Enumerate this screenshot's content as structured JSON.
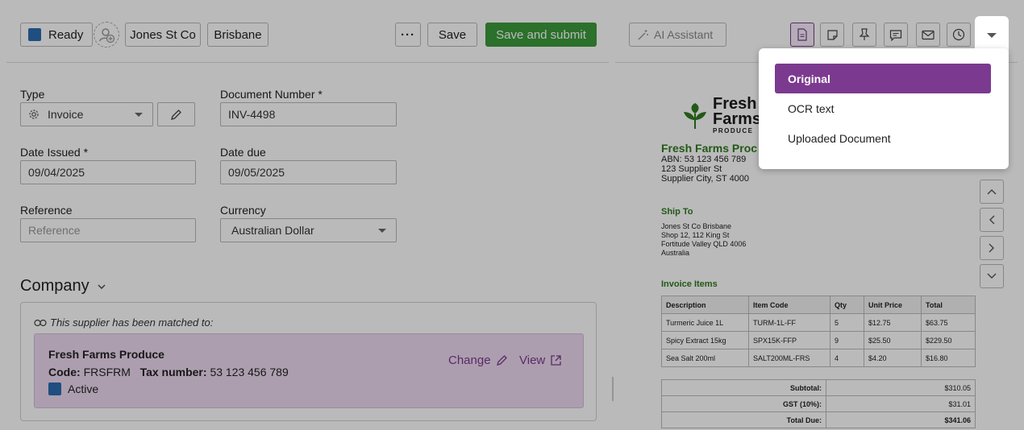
{
  "toolbar": {
    "status_label": "Ready",
    "tag_1": "Jones St Co",
    "tag_2": "Brisbane",
    "more_label": "···",
    "save_label": "Save",
    "submit_label": "Save and submit"
  },
  "form": {
    "type_label": "Type",
    "type_value": "Invoice",
    "doc_number_label": "Document Number *",
    "doc_number_value": "INV-4498",
    "date_issued_label": "Date Issued *",
    "date_issued_value": "09/04/2025",
    "date_due_label": "Date due",
    "date_due_value": "09/05/2025",
    "reference_label": "Reference",
    "reference_placeholder": "Reference",
    "currency_label": "Currency",
    "currency_value": "Australian Dollar"
  },
  "company": {
    "heading": "Company",
    "matched_text": "This supplier has been matched to:",
    "supplier_name": "Fresh Farms Produce",
    "code_label": "Code:",
    "code_value": "FRSFRM",
    "tax_label": "Tax number:",
    "tax_value": "53 123 456 789",
    "status": "Active",
    "change_label": "Change",
    "view_label": "View"
  },
  "right_toolbar": {
    "ai_label": "AI Assistant"
  },
  "dropdown": {
    "items": [
      "Original",
      "OCR text",
      "Uploaded Document"
    ],
    "selected": "Original"
  },
  "document": {
    "logo_line1": "Fresh",
    "logo_line2": "Farms",
    "logo_sub": "PRODUCE",
    "company_name": "Fresh Farms Proc",
    "abn": "ABN: 53 123 456 789",
    "address1": "123 Supplier St",
    "address2": "Supplier City, ST 4000",
    "ship_to_heading": "Ship To",
    "ship_to_lines": [
      "Jones St Co Brisbane",
      "Shop 12, 112 King St",
      "Fortitude Valley QLD 4006",
      "Australia"
    ],
    "items_heading": "Invoice Items",
    "table_headers": [
      "Description",
      "Item Code",
      "Qty",
      "Unit Price",
      "Total"
    ],
    "rows": [
      [
        "Turmeric Juice 1L",
        "TURM-1L-FF",
        "5",
        "$12.75",
        "$63.75"
      ],
      [
        "Spicy Extract 15kg",
        "SPX15K-FFP",
        "9",
        "$25.50",
        "$229.50"
      ],
      [
        "Sea Salt 200ml",
        "SALT200ML-FRS",
        "4",
        "$4.20",
        "$16.80"
      ]
    ],
    "subtotal_label": "Subtotal:",
    "subtotal_value": "$310.05",
    "gst_label": "GST (10%):",
    "gst_value": "$31.01",
    "total_label": "Total Due:",
    "total_value": "$341.06"
  },
  "colors": {
    "accent": "#7b3a8f",
    "submit_green": "#3c9a3c",
    "status_blue": "#2c6cb0",
    "doc_green": "#2f7a1f"
  }
}
